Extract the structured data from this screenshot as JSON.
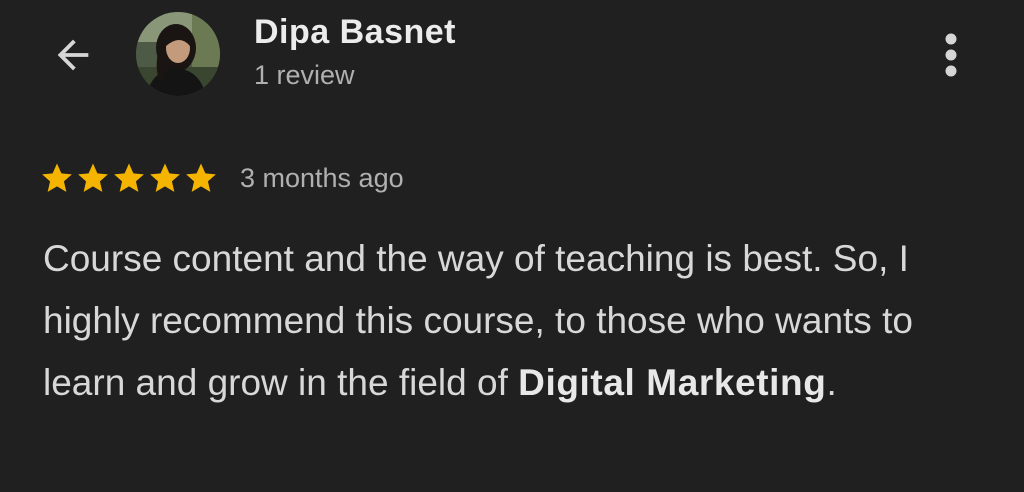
{
  "header": {
    "back_icon": "arrow-back-icon",
    "more_icon": "more-vert-icon",
    "avatar_icon": "user-avatar",
    "reviewer_name": "Dipa Basnet",
    "review_count": "1 review"
  },
  "review": {
    "rating": 5,
    "rating_max": 5,
    "star_color": "#f4b400",
    "date": "3 months ago",
    "text_part1": "Course content and the way of teaching is best. So, I highly recommend this course, to those who wants to learn and grow in the field of ",
    "text_bold": "Digital Marketing",
    "text_end": "."
  },
  "colors": {
    "background": "#202020",
    "primary_text": "#e3e3e3",
    "secondary_text": "#b0b0b0"
  }
}
